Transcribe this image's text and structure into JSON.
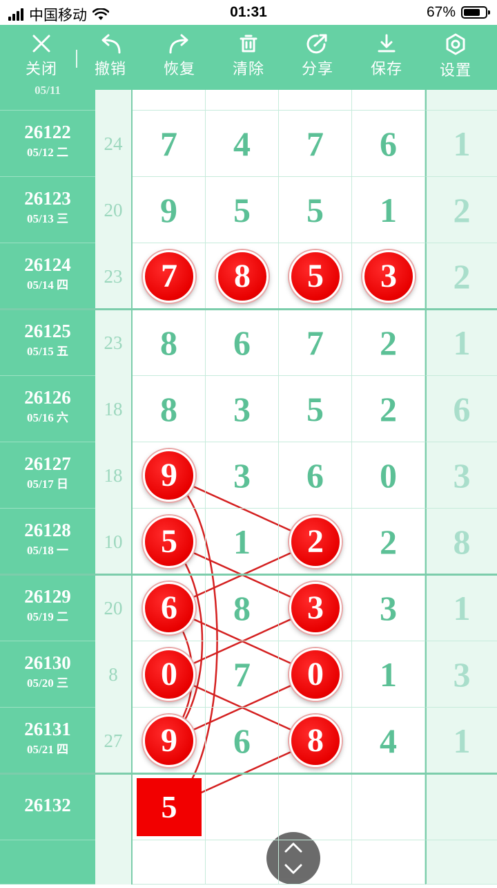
{
  "status_bar": {
    "carrier": "中国移动",
    "time": "01:31",
    "battery": "67%"
  },
  "toolbar": {
    "items": [
      {
        "icon": "close-icon",
        "label": "关闭"
      },
      {
        "icon": "undo-icon",
        "label": "撤销"
      },
      {
        "icon": "redo-icon",
        "label": "恢复"
      },
      {
        "icon": "trash-icon",
        "label": "清除"
      },
      {
        "icon": "share-icon",
        "label": "分享"
      },
      {
        "icon": "download-icon",
        "label": "保存"
      },
      {
        "icon": "settings-icon",
        "label": "设置"
      }
    ]
  },
  "table": {
    "partial_top_date": "05/11",
    "rows": [
      {
        "period": "26122",
        "date": "05/12 二",
        "sum": "24",
        "digits": [
          "7",
          "4",
          "7",
          "6"
        ],
        "extra": "1"
      },
      {
        "period": "26123",
        "date": "05/13 三",
        "sum": "20",
        "digits": [
          "9",
          "5",
          "5",
          "1"
        ],
        "extra": "2"
      },
      {
        "period": "26124",
        "date": "05/14 四",
        "sum": "23",
        "digits": [
          "7",
          "8",
          "5",
          "3"
        ],
        "extra": "2"
      },
      {
        "period": "26125",
        "date": "05/15 五",
        "sum": "23",
        "digits": [
          "8",
          "6",
          "7",
          "2"
        ],
        "extra": "1"
      },
      {
        "period": "26126",
        "date": "05/16 六",
        "sum": "18",
        "digits": [
          "8",
          "3",
          "5",
          "2"
        ],
        "extra": "6"
      },
      {
        "period": "26127",
        "date": "05/17 日",
        "sum": "18",
        "digits": [
          "9",
          "3",
          "6",
          "0"
        ],
        "extra": "3"
      },
      {
        "period": "26128",
        "date": "05/18 一",
        "sum": "10",
        "digits": [
          "5",
          "1",
          "2",
          "2"
        ],
        "extra": "8"
      },
      {
        "period": "26129",
        "date": "05/19 二",
        "sum": "20",
        "digits": [
          "6",
          "8",
          "3",
          "3"
        ],
        "extra": "1"
      },
      {
        "period": "26130",
        "date": "05/20 三",
        "sum": "8",
        "digits": [
          "0",
          "7",
          "0",
          "1"
        ],
        "extra": "3"
      },
      {
        "period": "26131",
        "date": "05/21 四",
        "sum": "27",
        "digits": [
          "9",
          "6",
          "8",
          "4"
        ],
        "extra": "1"
      },
      {
        "period": "26132",
        "date": "",
        "sum": "",
        "digits": [
          "5",
          "",
          "",
          ""
        ],
        "extra": ""
      }
    ],
    "highlighted": [
      {
        "row": 2,
        "col": 0
      },
      {
        "row": 2,
        "col": 1
      },
      {
        "row": 2,
        "col": 2
      },
      {
        "row": 2,
        "col": 3
      },
      {
        "row": 5,
        "col": 0
      },
      {
        "row": 6,
        "col": 0
      },
      {
        "row": 6,
        "col": 2
      },
      {
        "row": 7,
        "col": 0
      },
      {
        "row": 7,
        "col": 2
      },
      {
        "row": 8,
        "col": 0
      },
      {
        "row": 8,
        "col": 2
      },
      {
        "row": 9,
        "col": 0
      },
      {
        "row": 9,
        "col": 2
      }
    ],
    "prediction": {
      "row": 10,
      "col": 0,
      "value": "5"
    }
  },
  "colors": {
    "theme_green": "#66d1a4",
    "digit_green": "#5cc096",
    "ball_red": "#e80000",
    "line_red": "#d42020"
  }
}
